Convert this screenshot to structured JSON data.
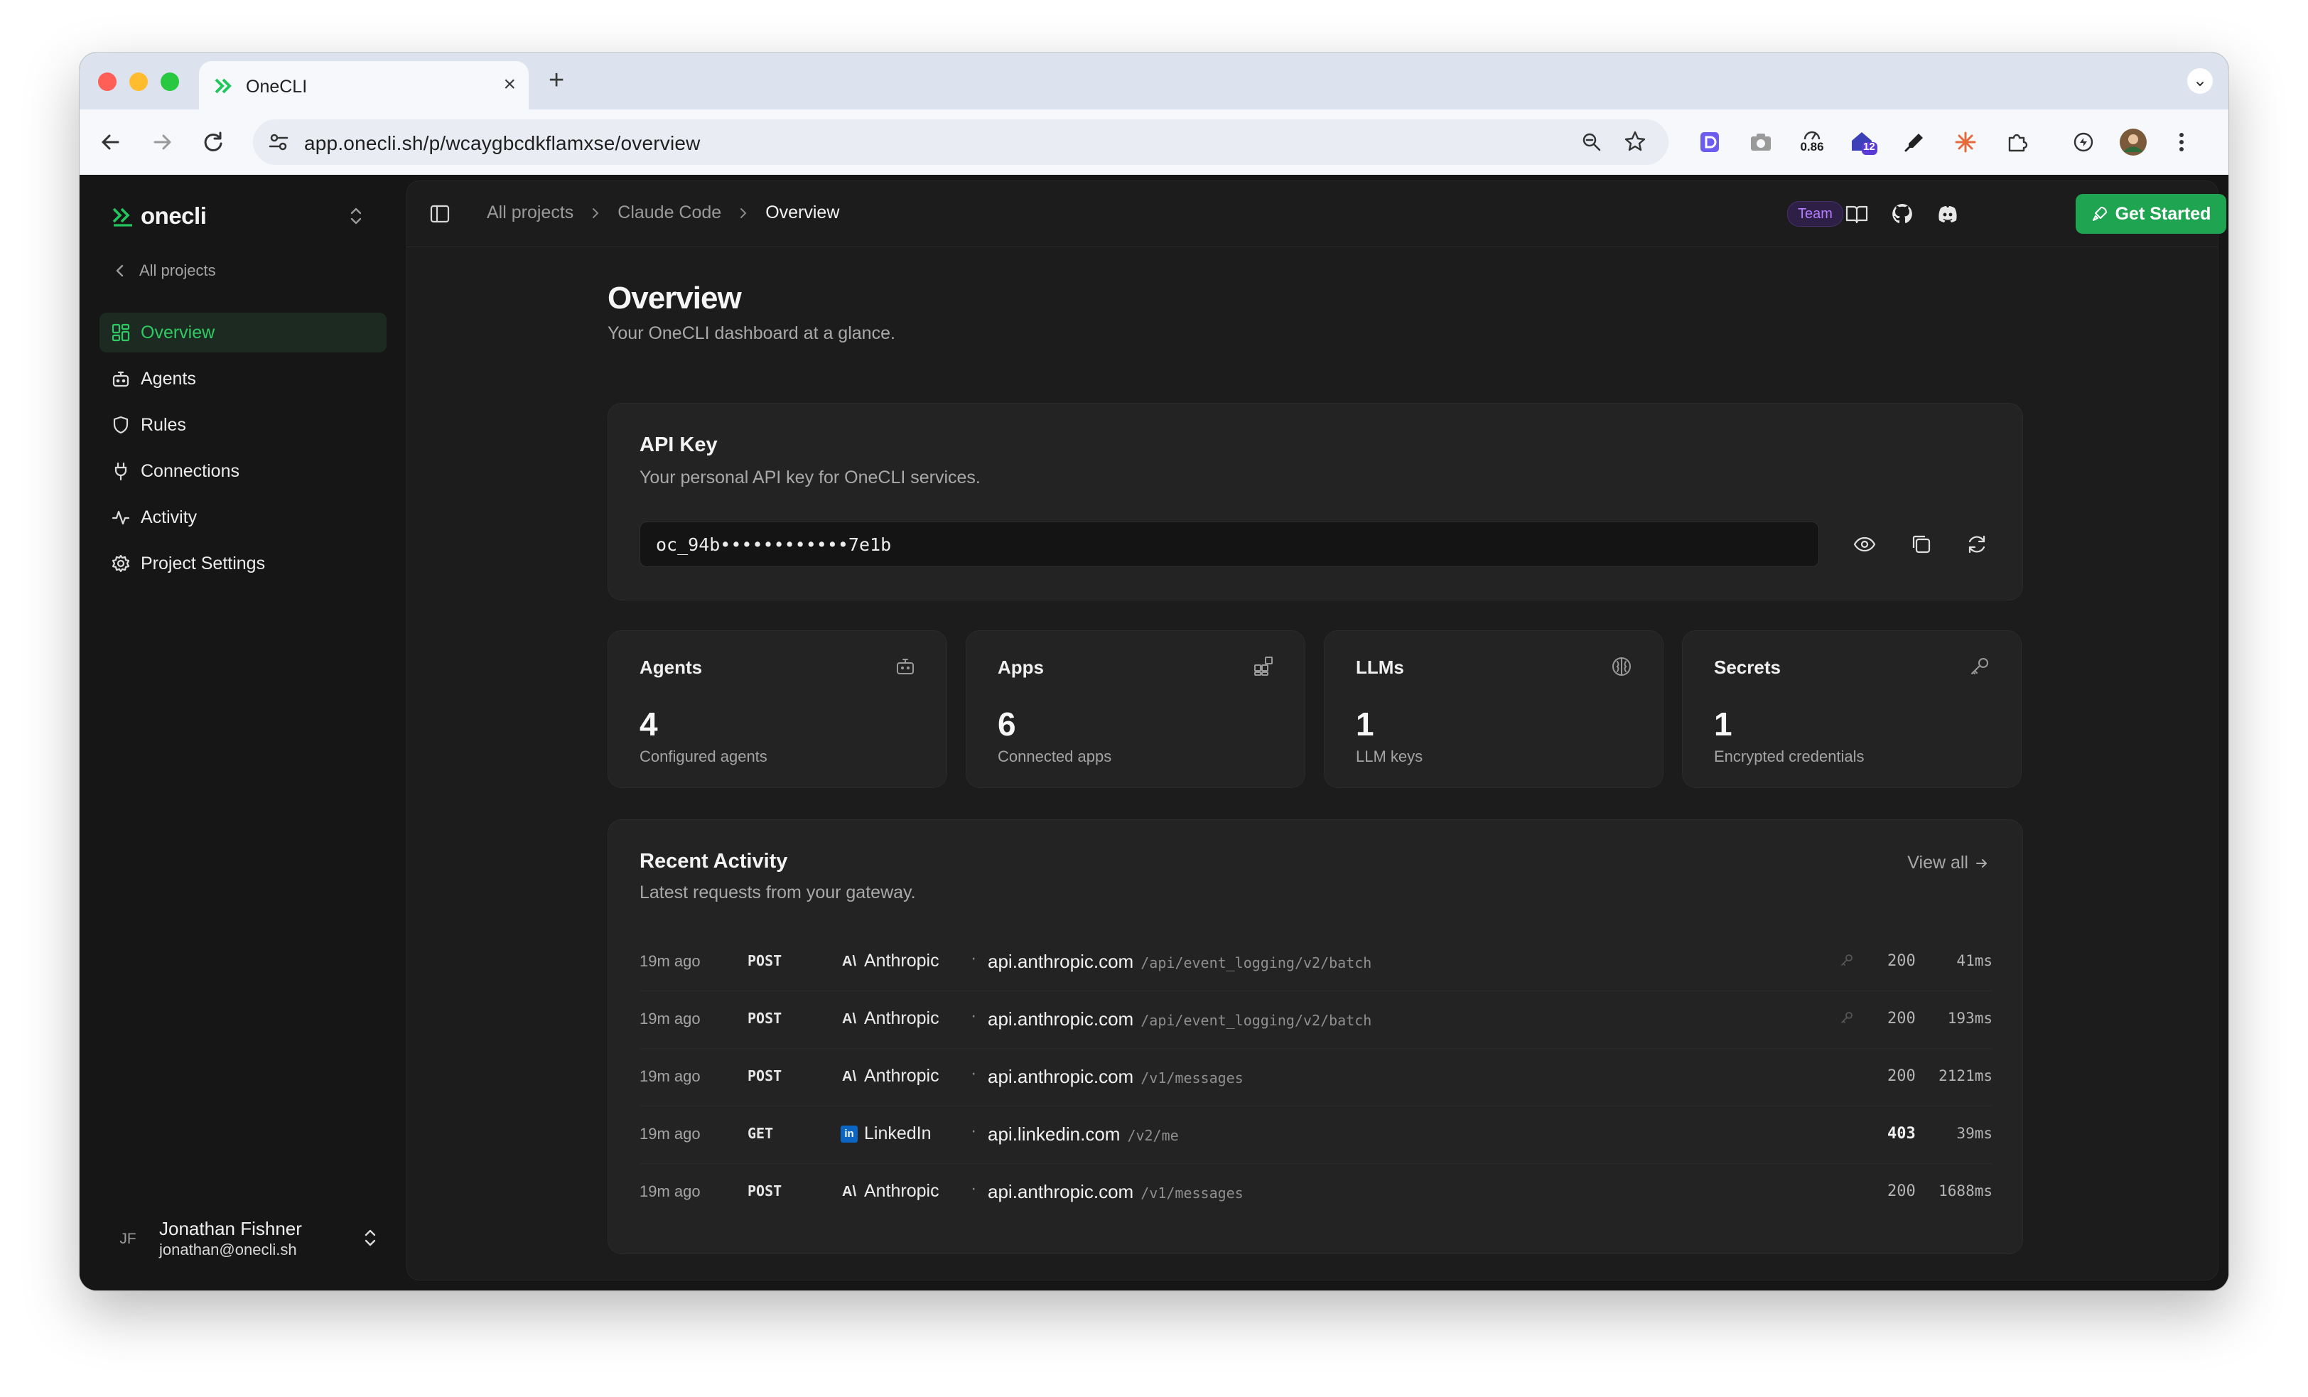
{
  "browser": {
    "tab_title": "OneCLI",
    "url": "app.onecli.sh/p/wcaygbcdkflamxse/overview",
    "extensions": {
      "badge_metric": "0.86",
      "badge_count": "12"
    },
    "colors": {
      "close": "#ff5f57",
      "minimize": "#febc2e",
      "maximize": "#28c840"
    }
  },
  "sidebar": {
    "brand": "onecli",
    "back_link": "All projects",
    "items": [
      {
        "label": "Overview",
        "icon": "grid-icon",
        "active": true
      },
      {
        "label": "Agents",
        "icon": "bot-icon"
      },
      {
        "label": "Rules",
        "icon": "shield-icon"
      },
      {
        "label": "Connections",
        "icon": "plug-icon"
      },
      {
        "label": "Activity",
        "icon": "activity-icon"
      },
      {
        "label": "Project Settings",
        "icon": "gear-icon"
      }
    ],
    "user": {
      "initials": "JF",
      "name": "Jonathan Fishner",
      "email": "jonathan@onecli.sh"
    }
  },
  "header": {
    "breadcrumb": [
      "All projects",
      "Claude Code",
      "Overview"
    ],
    "team_badge": "Team",
    "cta": "Get Started",
    "accent": "#1fa452"
  },
  "page": {
    "title": "Overview",
    "subtitle": "Your OneCLI dashboard at a glance."
  },
  "api_key": {
    "title": "API Key",
    "subtitle": "Your personal API key for OneCLI services.",
    "value": "oc_94b••••••••••••7e1b"
  },
  "stats": [
    {
      "label": "Agents",
      "value": "4",
      "caption": "Configured agents",
      "icon": "bot-icon"
    },
    {
      "label": "Apps",
      "value": "6",
      "caption": "Connected apps",
      "icon": "apps-icon"
    },
    {
      "label": "LLMs",
      "value": "1",
      "caption": "LLM keys",
      "icon": "brain-icon"
    },
    {
      "label": "Secrets",
      "value": "1",
      "caption": "Encrypted credentials",
      "icon": "key-icon"
    }
  ],
  "activity": {
    "title": "Recent Activity",
    "subtitle": "Latest requests from your gateway.",
    "view_all": "View all",
    "rows": [
      {
        "time": "19m ago",
        "method": "POST",
        "provider": "Anthropic",
        "provider_icon": "anthropic-icon",
        "host": "api.anthropic.com",
        "path": "/api/event_logging/v2/batch",
        "key": true,
        "status": "200",
        "duration": "41ms"
      },
      {
        "time": "19m ago",
        "method": "POST",
        "provider": "Anthropic",
        "provider_icon": "anthropic-icon",
        "host": "api.anthropic.com",
        "path": "/api/event_logging/v2/batch",
        "key": true,
        "status": "200",
        "duration": "193ms"
      },
      {
        "time": "19m ago",
        "method": "POST",
        "provider": "Anthropic",
        "provider_icon": "anthropic-icon",
        "host": "api.anthropic.com",
        "path": "/v1/messages",
        "key": false,
        "status": "200",
        "duration": "2121ms"
      },
      {
        "time": "19m ago",
        "method": "GET",
        "provider": "LinkedIn",
        "provider_icon": "linkedin-icon",
        "host": "api.linkedin.com",
        "path": "/v2/me",
        "key": false,
        "status": "403",
        "duration": "39ms"
      },
      {
        "time": "19m ago",
        "method": "POST",
        "provider": "Anthropic",
        "provider_icon": "anthropic-icon",
        "host": "api.anthropic.com",
        "path": "/v1/messages",
        "key": false,
        "status": "200",
        "duration": "1688ms"
      }
    ]
  }
}
